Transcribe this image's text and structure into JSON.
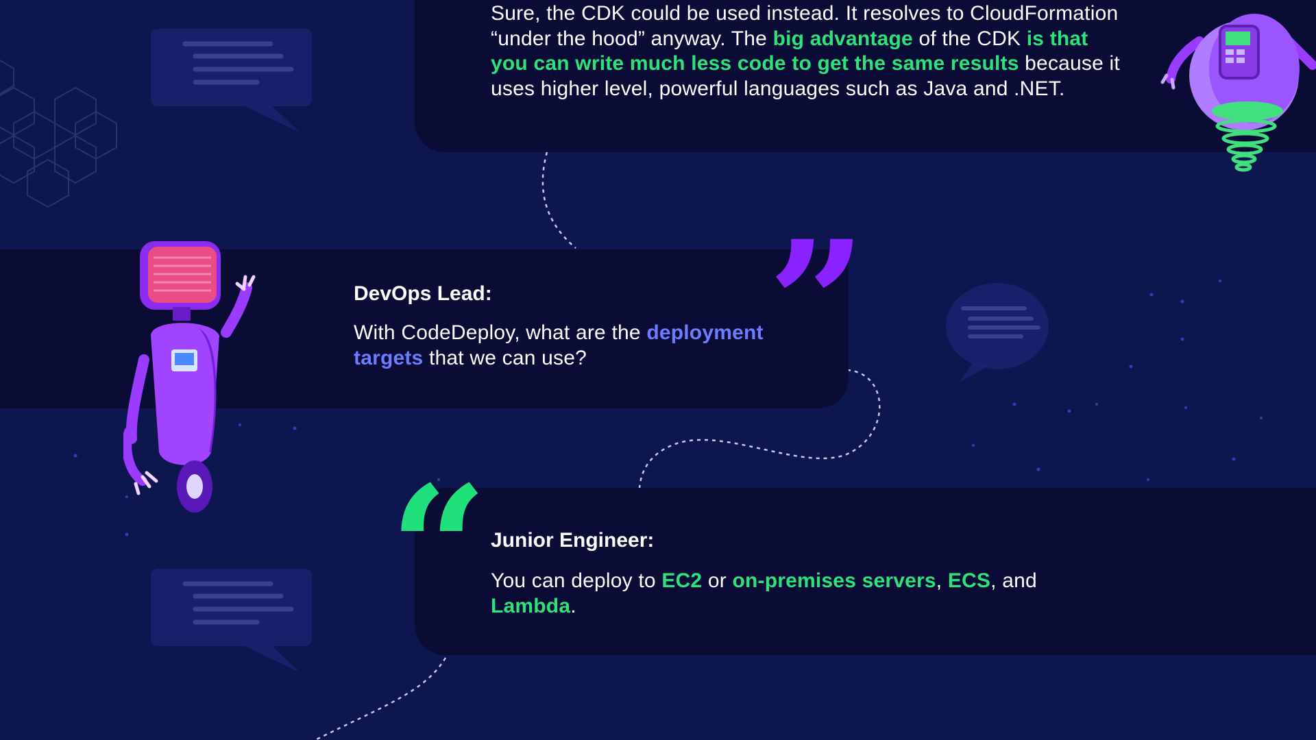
{
  "colors": {
    "background": "#0e1650",
    "card": "#0b0c36",
    "highlight_green": "#2ee27a",
    "highlight_blue": "#6e7cff",
    "quote_purple": "#8a22ff",
    "quote_green": "#1fe07a"
  },
  "conversation": {
    "top_message": {
      "parts": [
        "Sure, the CDK could be used instead. It resolves to CloudFormation “under the hood” anyway. The ",
        "big advantage",
        " of the CDK ",
        "is that you can write much less code to get the same results",
        " because it uses higher level, powerful languages such as Java and .NET."
      ]
    },
    "devops": {
      "speaker": "DevOps Lead:",
      "parts": [
        "With CodeDeploy, what are the ",
        "deployment targets",
        " that we can use?"
      ]
    },
    "junior": {
      "speaker": "Junior Engineer:",
      "parts": [
        "You can deploy to ",
        "EC2",
        " or ",
        "on-premises servers",
        ", ",
        "ECS",
        ", and ",
        "Lambda",
        "."
      ]
    }
  },
  "icons": {
    "quote_close": "closing-quote-icon",
    "quote_open": "opening-quote-icon",
    "speech_bubble": "speech-bubble-icon",
    "robot": "robot-illustration"
  }
}
